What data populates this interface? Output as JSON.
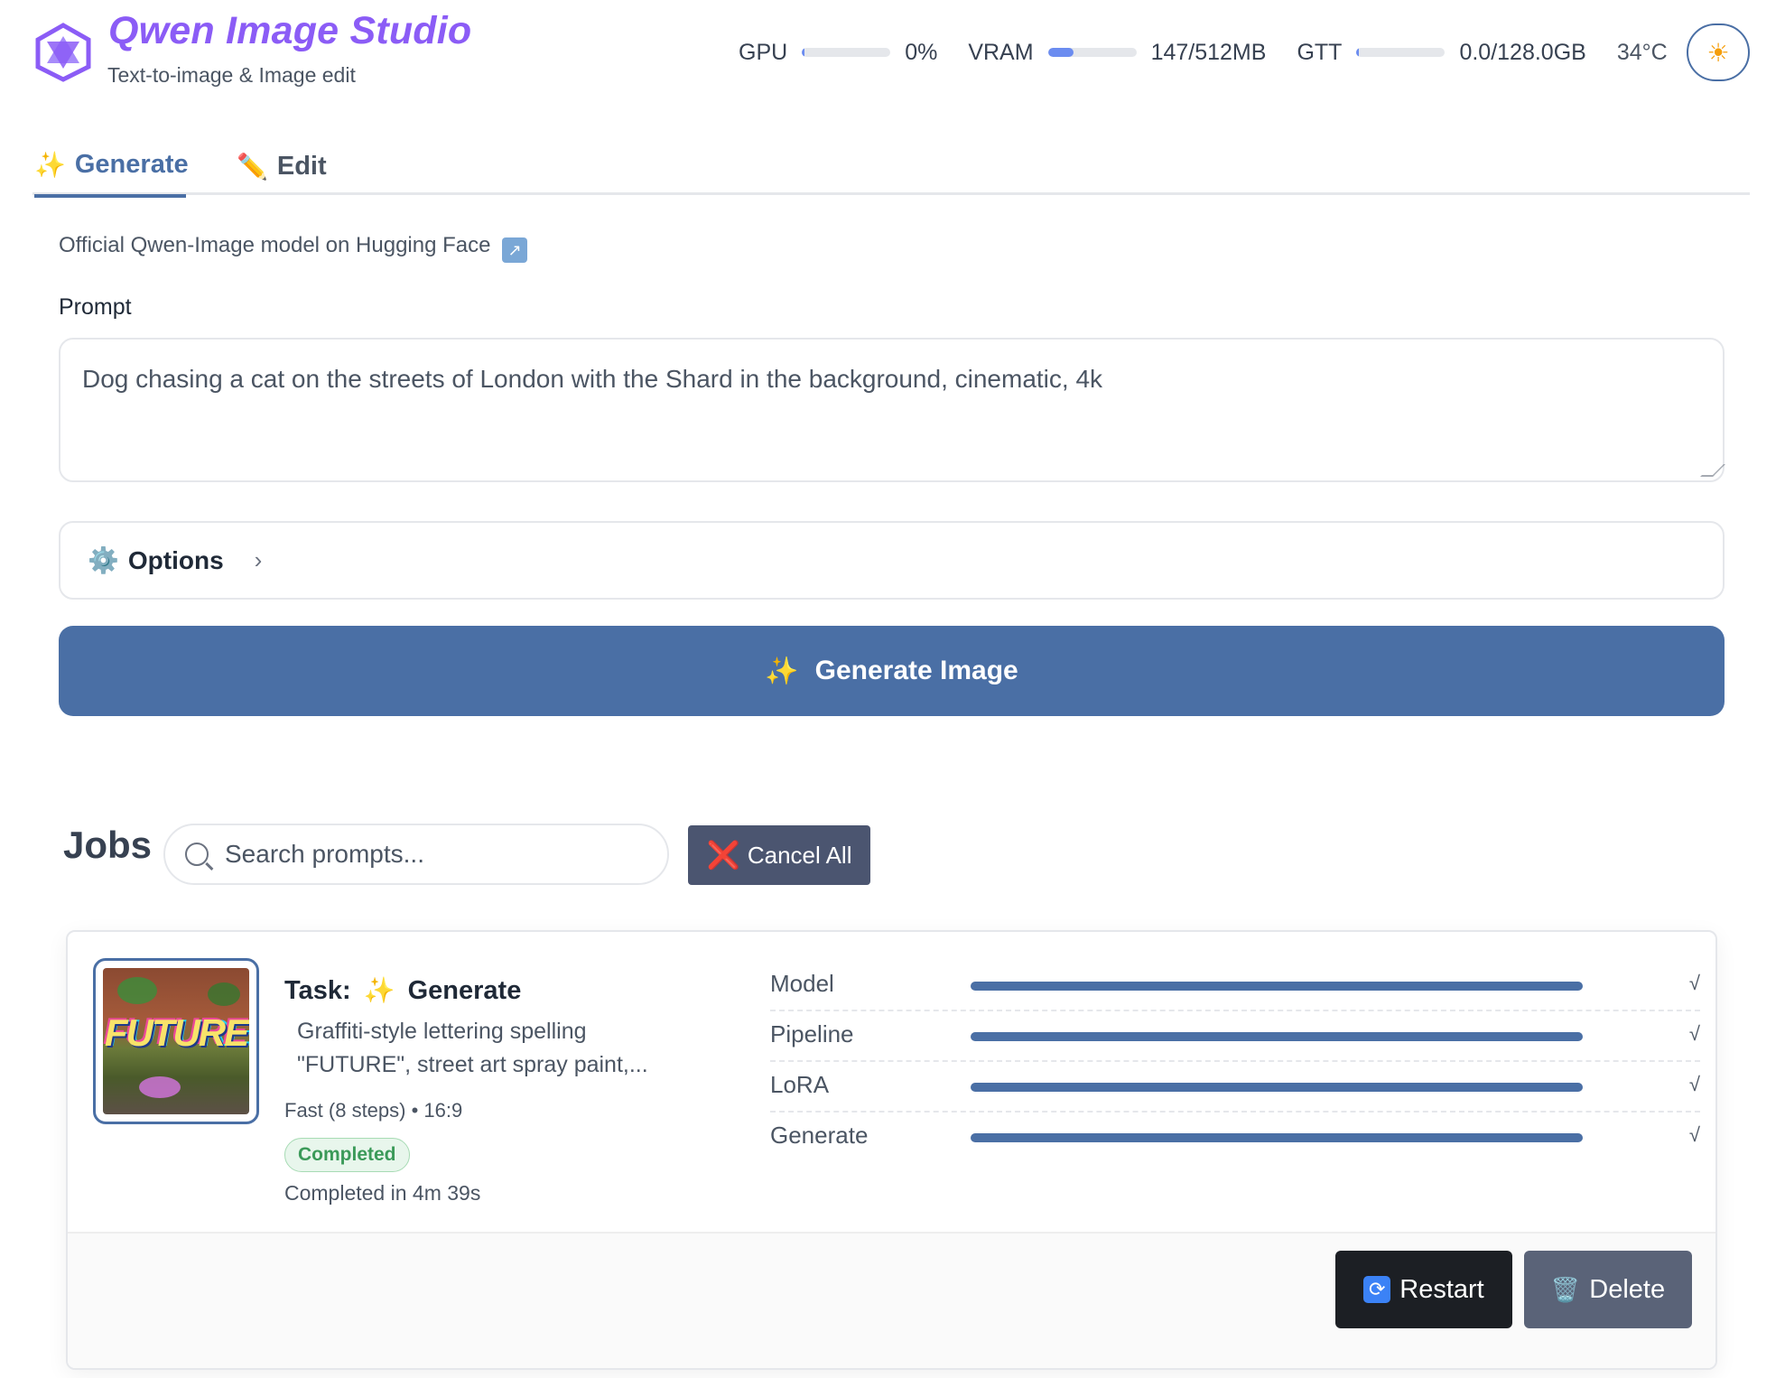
{
  "header": {
    "title": "Qwen Image Studio",
    "subtitle": "Text-to-image & Image edit",
    "stats": {
      "gpu": {
        "label": "GPU",
        "value": "0%",
        "fill": 0.02
      },
      "vram": {
        "label": "VRAM",
        "value": "147/512MB",
        "fill": 0.29
      },
      "gtt": {
        "label": "GTT",
        "value": "0.0/128.0GB",
        "fill": 0.02
      },
      "temp": "34°C"
    },
    "theme_icon": "sun-icon",
    "theme_glyph": "☀"
  },
  "tabs": [
    {
      "icon": "✨",
      "label": "Generate",
      "active": true
    },
    {
      "icon": "✏️",
      "label": "Edit",
      "active": false
    }
  ],
  "form": {
    "model_link": "Official Qwen-Image model on Hugging Face",
    "model_link_icon": "↗",
    "prompt_label": "Prompt",
    "prompt_value": "Dog chasing a cat on the streets of London with the Shard in the background, cinematic, 4k",
    "options_label": "Options",
    "options_icon": "⚙️",
    "options_chevron": "›",
    "generate_icon": "✨",
    "generate_label": "Generate Image"
  },
  "jobs": {
    "title": "Jobs",
    "search_placeholder": "Search prompts...",
    "cancel_all_icon": "❌",
    "cancel_all_label": "Cancel All",
    "items": [
      {
        "thumbnail_text": "FUTURE",
        "task_prefix": "Task:",
        "task_icon": "✨",
        "task_name": "Generate",
        "prompt": "Graffiti-style lettering spelling \"FUTURE\", street art spray paint,...",
        "meta": "Fast (8 steps) • 16:9",
        "status": "Completed",
        "duration": "Completed in 4m 39s",
        "steps": [
          {
            "name": "Model",
            "progress": 1.0,
            "done": "√"
          },
          {
            "name": "Pipeline",
            "progress": 1.0,
            "done": "√"
          },
          {
            "name": "LoRA",
            "progress": 1.0,
            "done": "√"
          },
          {
            "name": "Generate",
            "progress": 1.0,
            "done": "√"
          }
        ],
        "restart_icon": "🔄",
        "restart_label": "Restart",
        "delete_icon": "🗑️",
        "delete_label": "Delete"
      }
    ]
  },
  "colors": {
    "accent": "#4a6fa5",
    "brand": "#8b5cf6",
    "success": "#3b9a59"
  }
}
